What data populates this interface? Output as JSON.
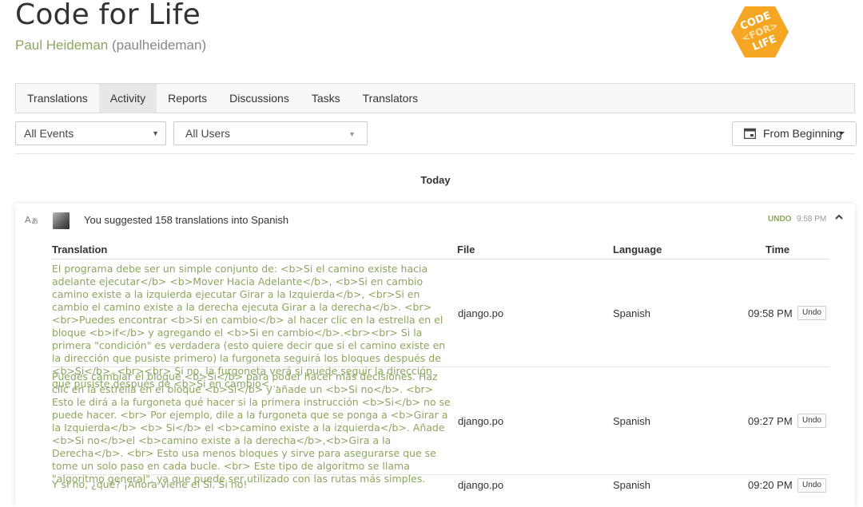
{
  "header": {
    "title": "Code for Life",
    "user_name": "Paul Heideman",
    "user_handle": "(paulheideman)",
    "logo_lines": [
      "CODE",
      "<FOR>",
      "LIFE"
    ]
  },
  "nav": {
    "tabs": [
      "Translations",
      "Activity",
      "Reports",
      "Discussions",
      "Tasks",
      "Translators"
    ]
  },
  "filters": {
    "events": "All Events",
    "users": "All Users",
    "date": "From Beginning"
  },
  "day_label": "Today",
  "activity": {
    "summary": "You suggested 158 translations into Spanish",
    "undo_label": "UNDO",
    "time": "9:58 PM",
    "columns": {
      "translation": "Translation",
      "file": "File",
      "language": "Language",
      "time": "Time"
    },
    "rows": [
      {
        "text": "El programa debe ser un simple conjunto de: <b>Si el camino existe hacia adelante ejecutar</b> <b>Mover Hacia Adelante</b>, <b>Si en cambio camino existe a la izquierda ejecutar Girar a la Izquierda</b>, <br>Si en cambio el camino existe a la derecha ejecuta Girar a la derecha</b>. <br><br>Puedes encontrar <b>Si en cambio</b> al hacer clic en la estrella en el bloque <b>if</b> y agregando el <b>Si en cambio</b>.<br><br> Si la primera \"condición\" es verdadera (esto quiere decir que si el camino existe en la dirección que pusiste primero) la furgoneta seguirá los bloques después de <b>Si</b>. <br><br> Si no, la furgoneta verá si puede seguir la dirección que pusiste después de <b>Si en cambio<...",
        "file": "django.po",
        "language": "Spanish",
        "time": "09:58 PM",
        "undo": "Undo"
      },
      {
        "text": "Puedes cambiar el bloque <b>Si</b> para poder hacer más decisiones. Haz clic en la estrella en el bloque <b>Si</b> y añade un <b>Si no</b>. <br> Esto le dirá a la furgoneta qué hacer si la primera instrucción <b>Si</b> no se puede hacer. <br> Por ejemplo, dile a la furgoneta que se ponga a <b>Girar a la Izquierda</b> <b> Si</b> el <b>camino existe a la izquierda</b>. Añade <b>Si no</b>el <b>camino existe a la derecha</b>,<b>Gira a la Derecha</b>. <br> Esto usa menos bloques y sirve para asegurarse que se tome un solo paso en cada bucle. <br> Este tipo de algoritmo se llama \"algoritmo general\", ya que puede ser utilizado con las rutas más simples.",
        "file": "django.po",
        "language": "Spanish",
        "time": "09:27 PM",
        "undo": "Undo"
      },
      {
        "text": "Y si no, ¿qué? ¡Ahora viene el Si. Si no!",
        "file": "django.po",
        "language": "Spanish",
        "time": "09:20 PM",
        "undo": "Undo"
      }
    ]
  }
}
